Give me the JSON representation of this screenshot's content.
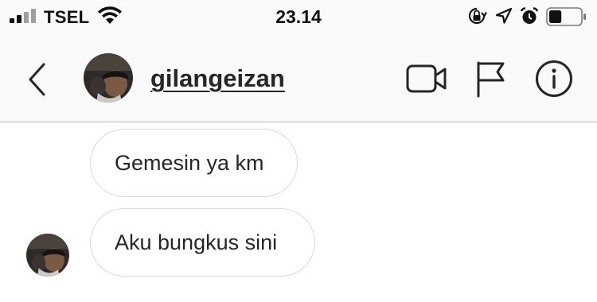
{
  "status_bar": {
    "carrier": "TSEL",
    "time": "23.14",
    "icons": [
      "signal-bars-icon",
      "wifi-icon",
      "orientation-lock-icon",
      "location-arrow-icon",
      "alarm-clock-icon",
      "battery-icon"
    ],
    "battery_level": 0.4
  },
  "header": {
    "username": "gilangeizan",
    "icons": [
      "back-chevron-icon",
      "video-camera-icon",
      "flag-icon",
      "info-icon"
    ]
  },
  "messages": [
    {
      "text": "Gemesin ya km"
    },
    {
      "text": "Aku bungkus sini"
    }
  ]
}
